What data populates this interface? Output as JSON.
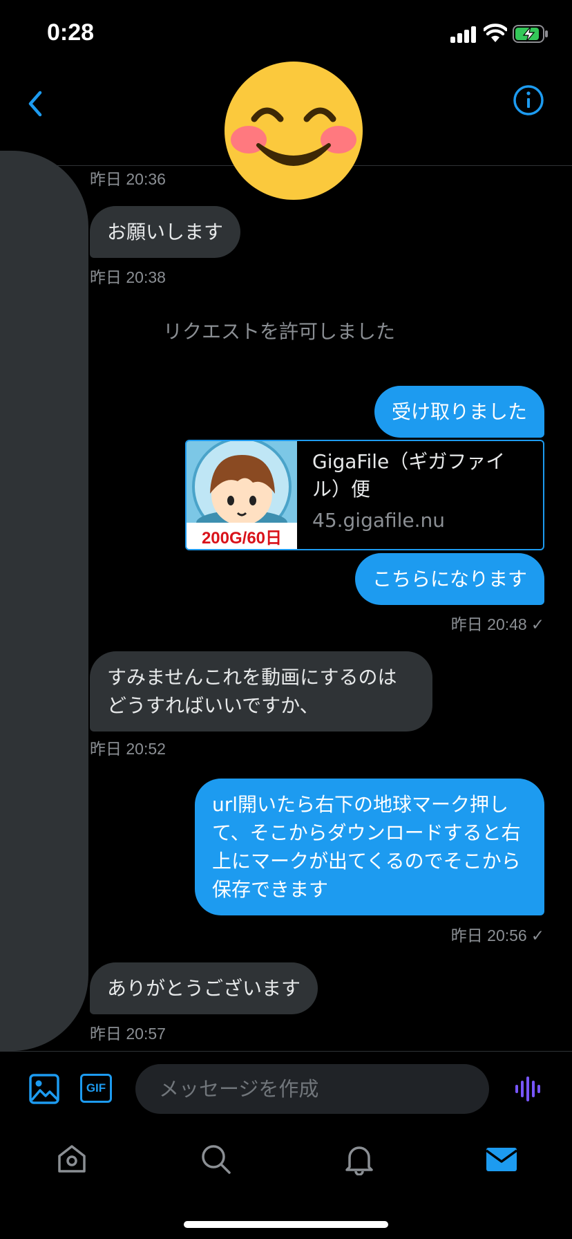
{
  "status_bar": {
    "time": "0:28"
  },
  "header": {
    "avatar_icon": "smiling-face-with-smiling-eyes-emoji"
  },
  "system": {
    "request_allowed": "リクエストを許可しました"
  },
  "messages": [
    {
      "ts": "昨日 20:36"
    },
    {
      "text": "お願いします",
      "ts": "昨日 20:38"
    },
    {
      "text": "受け取りました"
    },
    {
      "link_title": "GigaFile（ギガファイル）便",
      "link_domain": "45.gigafile.nu",
      "thumb_caption": "200G/60日"
    },
    {
      "text": "こちらになります",
      "ts": "昨日 20:48",
      "check": "✓"
    },
    {
      "text": "すみませんこれを動画にするのは\nどうすればいいですか、",
      "ts": "昨日 20:52"
    },
    {
      "text": "url開いたら右下の地球マーク押して、そこからダウンロードすると右上にマークが出てくるのでそこから保存できます",
      "ts": "昨日 20:56",
      "check": "✓"
    },
    {
      "text": "ありがとうございます",
      "ts": "昨日 20:57"
    }
  ],
  "composer": {
    "placeholder": "メッセージを作成",
    "gif_label": "GIF"
  },
  "colors": {
    "accent": "#1d9bf0",
    "incoming": "#2f3336",
    "voice": "#7856ff"
  }
}
